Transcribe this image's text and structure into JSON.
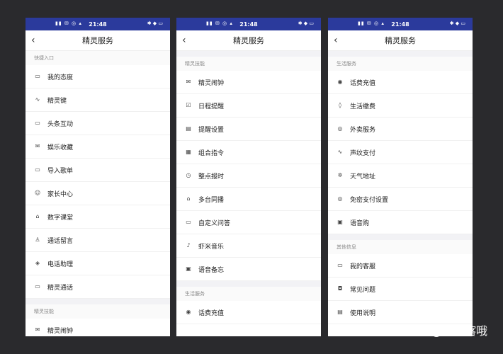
{
  "status": {
    "time": "21:48",
    "left_icons": "▮▮ ✉ ◎ ▴",
    "right_icons": "✱ ◆ ▭"
  },
  "screens": [
    {
      "title": "精灵服务",
      "sections": [
        {
          "label": "快捷入口",
          "items": [
            {
              "label": "我的态度",
              "icon": "▭"
            },
            {
              "label": "精灵键",
              "icon": "∿"
            },
            {
              "label": "头条互动",
              "icon": "▭"
            },
            {
              "label": "娱乐收藏",
              "icon": "✉"
            },
            {
              "label": "导入歌单",
              "icon": "▭"
            },
            {
              "label": "家长中心",
              "icon": "☺"
            },
            {
              "label": "数字课堂",
              "icon": "⌂"
            },
            {
              "label": "通话留言",
              "icon": "♙"
            },
            {
              "label": "电话助理",
              "icon": "◈"
            },
            {
              "label": "精灵通话",
              "icon": "▭"
            }
          ]
        },
        {
          "label": "精灵技能",
          "items": [
            {
              "label": "精灵闹钟",
              "icon": "✉"
            }
          ]
        }
      ]
    },
    {
      "title": "精灵服务",
      "sections": [
        {
          "label": "精灵技能",
          "items": [
            {
              "label": "精灵闹钟",
              "icon": "✉"
            },
            {
              "label": "日程提醒",
              "icon": "☑"
            },
            {
              "label": "提醒设置",
              "icon": "▤"
            },
            {
              "label": "组合指令",
              "icon": "▦"
            },
            {
              "label": "整点报时",
              "icon": "◷"
            },
            {
              "label": "多台同播",
              "icon": "⌂"
            },
            {
              "label": "自定义问答",
              "icon": "▭"
            },
            {
              "label": "虾米音乐",
              "icon": "♪"
            },
            {
              "label": "语音备忘",
              "icon": "▣"
            }
          ]
        },
        {
          "label": "生活服务",
          "items": [
            {
              "label": "话费充值",
              "icon": "◉"
            }
          ]
        }
      ]
    },
    {
      "title": "精灵服务",
      "sections": [
        {
          "label": "生活服务",
          "items": [
            {
              "label": "话费充值",
              "icon": "◉"
            },
            {
              "label": "生活缴费",
              "icon": "◊"
            },
            {
              "label": "外卖服务",
              "icon": "◎"
            },
            {
              "label": "声纹支付",
              "icon": "∿"
            },
            {
              "label": "天气地址",
              "icon": "✲"
            },
            {
              "label": "免密支付设置",
              "icon": "◎"
            },
            {
              "label": "语音购",
              "icon": "▣"
            }
          ]
        },
        {
          "label": "其他信息",
          "items": [
            {
              "label": "我的客服",
              "icon": "▭"
            },
            {
              "label": "常见问题",
              "icon": "◘"
            },
            {
              "label": "使用说明",
              "icon": "▤"
            }
          ]
        }
      ]
    }
  ],
  "watermark": "知乎 @科技喀哦"
}
